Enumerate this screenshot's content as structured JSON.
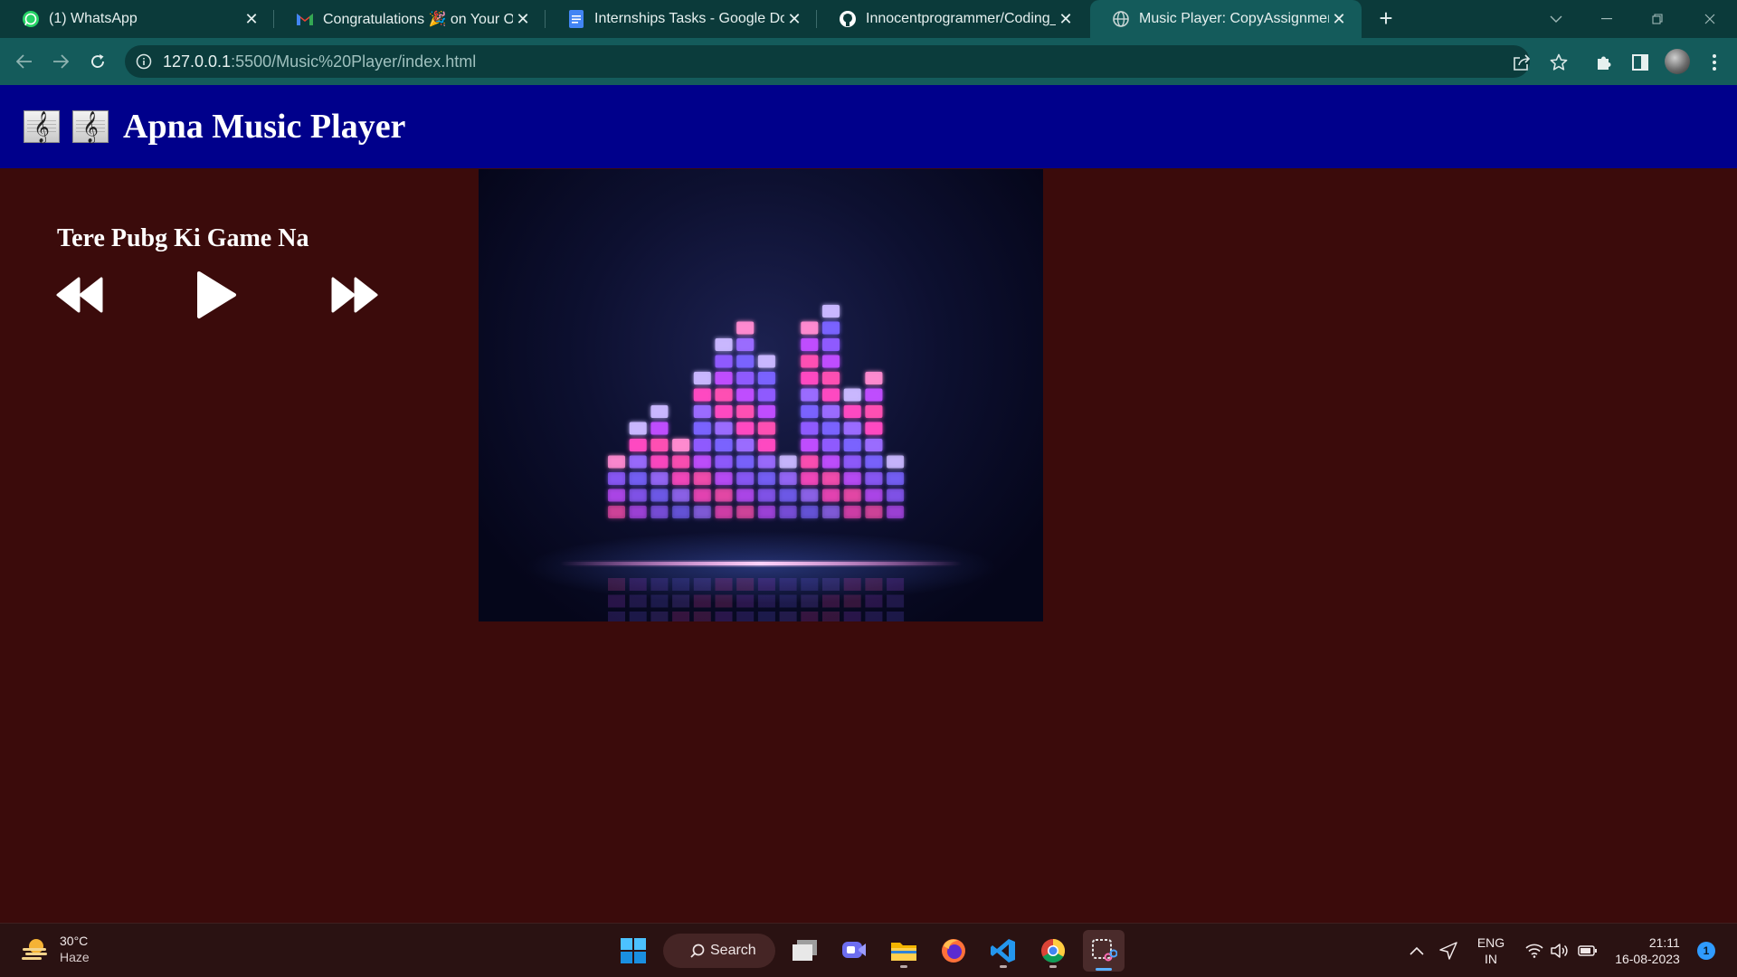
{
  "browser": {
    "tabs": [
      {
        "title": "(1) WhatsApp",
        "icon": "whatsapp-icon"
      },
      {
        "title": "Congratulations 🎉 on Your Offe",
        "icon": "gmail-icon"
      },
      {
        "title": "Internships Tasks - Google Docs",
        "icon": "google-docs-icon"
      },
      {
        "title": "Innocentprogrammer/Coding_Ra",
        "icon": "github-icon"
      },
      {
        "title": "Music Player: CopyAssignment",
        "icon": "globe-icon",
        "active": true
      }
    ],
    "url_host": "127.0.0.1",
    "url_path": ":5500/Music%20Player/index.html"
  },
  "page": {
    "header_title": "Apna Music Player",
    "header_icons": [
      "𝄞",
      "𝄞"
    ],
    "song_name": "Tere Pubg Ki Game Na",
    "controls": [
      "rewind-icon",
      "play-icon",
      "fast-forward-icon"
    ],
    "colors": {
      "header_bg": "#00008b",
      "page_bg": "#3b0b0b",
      "text": "#ffffff"
    }
  },
  "taskbar": {
    "weather": {
      "temp": "30°C",
      "condition": "Haze"
    },
    "search_label": "Search",
    "lang_top": "ENG",
    "lang_bottom": "IN",
    "time": "21:11",
    "date": "16-08-2023",
    "notification_count": "1"
  }
}
